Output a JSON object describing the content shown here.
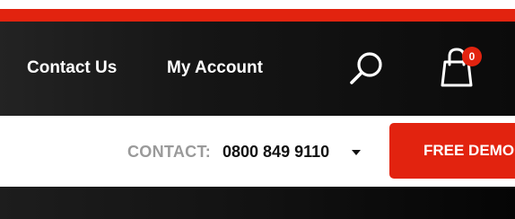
{
  "nav": {
    "links": [
      {
        "label": "Contact Us"
      },
      {
        "label": "My Account"
      }
    ],
    "search_icon": "search-icon",
    "cart_icon": "shopping-bag-icon",
    "cart_count": "0"
  },
  "contact": {
    "label": "CONTACT:",
    "phone": "0800 849 9110",
    "dropdown_icon": "caret-down-icon"
  },
  "cta": {
    "label": "FREE DEMO"
  },
  "colors": {
    "accent": "#e2230f",
    "nav_background": "#151515",
    "label_gray": "#9a9a9a"
  }
}
